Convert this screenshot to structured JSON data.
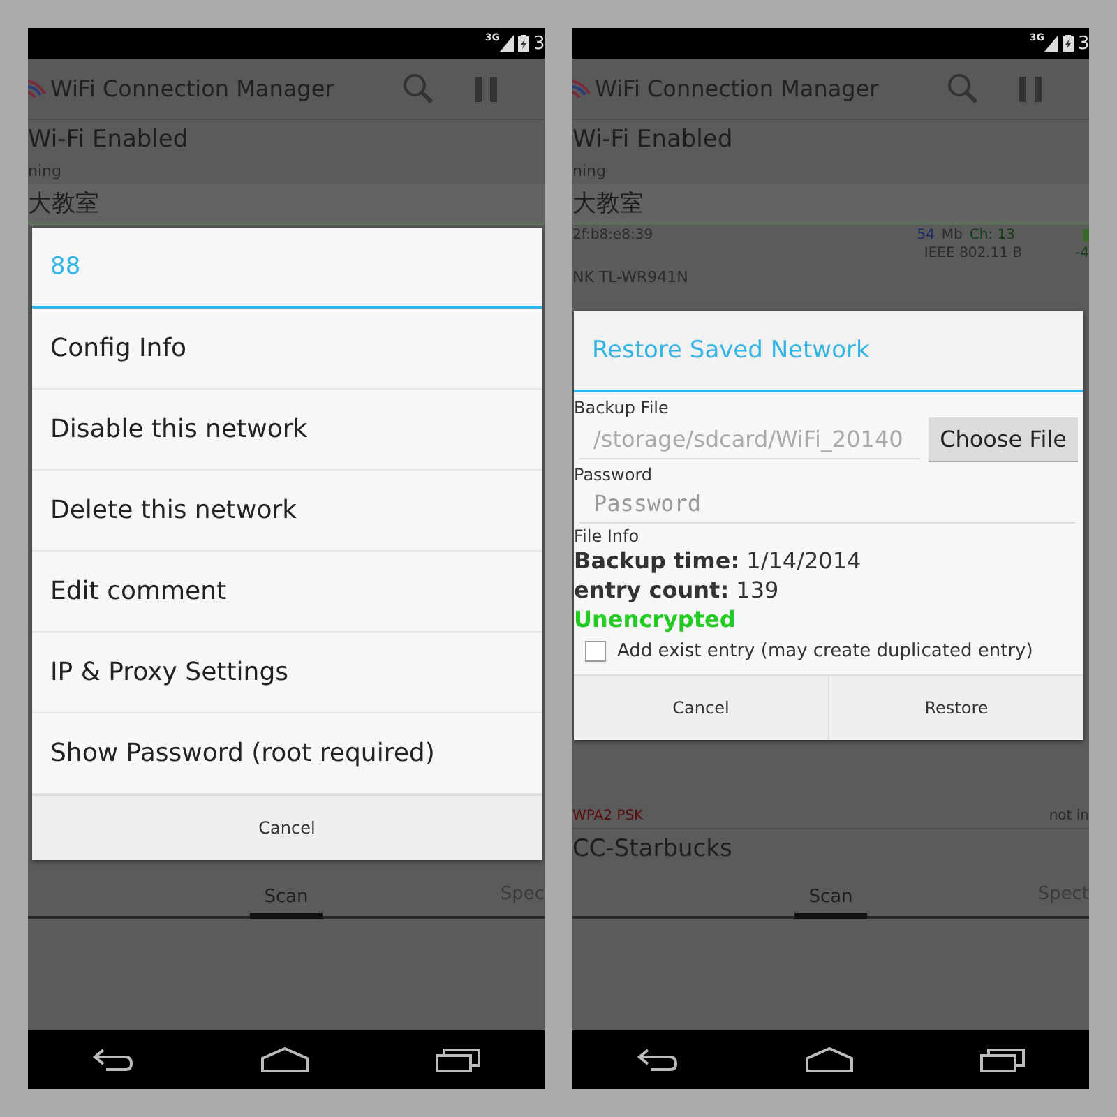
{
  "screens": [
    {
      "status_bar": {
        "network": "3G",
        "time": "3"
      },
      "app_bar": {
        "title": "WiFi Connection Manager"
      },
      "top_rows": [
        {
          "kind": "heading",
          "text": "Wi-Fi Enabled"
        },
        {
          "kind": "small",
          "text": "ning"
        },
        {
          "kind": "network",
          "text": "大教室"
        }
      ],
      "tabs": [
        {
          "label": "Scan",
          "selected": true
        },
        {
          "label": "Spec",
          "selected": false
        }
      ],
      "dialog": {
        "kind": "menu",
        "title": "88",
        "items": [
          "Config Info",
          "Disable this network",
          "Delete this network",
          "Edit comment",
          "IP & Proxy Settings",
          "Show Password (root required)"
        ],
        "buttons": [
          "Cancel"
        ]
      }
    },
    {
      "status_bar": {
        "network": "3G",
        "time": "3"
      },
      "app_bar": {
        "title": "WiFi Connection Manager"
      },
      "top_rows": [
        {
          "kind": "heading",
          "text": "Wi-Fi Enabled"
        },
        {
          "kind": "small",
          "text": "ning"
        },
        {
          "kind": "network",
          "text": "大教室"
        },
        {
          "kind": "details",
          "mac": "2f:b8:e8:39",
          "speed": "54",
          "unit": "Mb",
          "channel": "Ch: 13",
          "standard": "IEEE 802.11 B",
          "signal": "-4"
        },
        {
          "kind": "small",
          "text": "NK TL-WR941N"
        }
      ],
      "bottom_rows": [
        {
          "kind": "security",
          "text": "WPA2 PSK",
          "state": "not in"
        },
        {
          "kind": "heading",
          "text": "CC-Starbucks"
        }
      ],
      "tabs": [
        {
          "label": "Scan",
          "selected": true
        },
        {
          "label": "Spect",
          "selected": false
        }
      ],
      "dialog": {
        "kind": "form",
        "title": "Restore Saved Network",
        "file_label": "Backup File",
        "file_value": "/storage/sdcard/WiFi_20140",
        "choose_button": "Choose File",
        "password_label": "Password",
        "password_placeholder": "Password",
        "info_label": "File Info",
        "info_lines": [
          "**Backup time:** 1/14/2014",
          "**entry count:** 139"
        ],
        "encryption": "Unencrypted",
        "option": {
          "label": "Add exist entry (may create duplicated entry)",
          "checked": false
        },
        "buttons": [
          "Cancel",
          "Restore"
        ]
      }
    }
  ]
}
